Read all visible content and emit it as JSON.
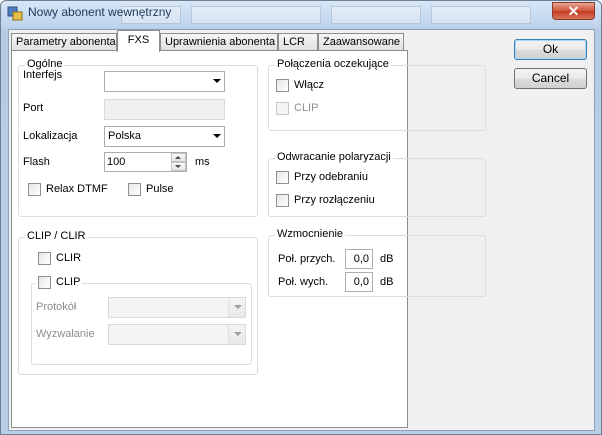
{
  "window": {
    "title": "Nowy abonent wewnętrzny",
    "close_glyph": "✕"
  },
  "tabs": [
    {
      "label": "Parametry abonenta",
      "active": false
    },
    {
      "label": "FXS",
      "active": true
    },
    {
      "label": "Uprawnienia abonenta",
      "active": false
    },
    {
      "label": "LCR",
      "active": false
    },
    {
      "label": "Zaawansowane",
      "active": false
    }
  ],
  "general": {
    "legend": "Ogólne",
    "interface_label": "Interfejs",
    "interface_value": "",
    "port_label": "Port",
    "location_label": "Lokalizacja",
    "location_value": "Polska",
    "flash_label": "Flash",
    "flash_value": "100",
    "flash_unit": "ms",
    "relax_dtmf_label": "Relax DTMF",
    "pulse_label": "Pulse"
  },
  "clip_clir": {
    "legend": "CLIP / CLIR",
    "clir_label": "CLIR",
    "clip_label": "CLIP",
    "protocol_label": "Protokół",
    "trigger_label": "Wyzwalanie"
  },
  "waiting_calls": {
    "legend": "Połączenia oczekujące",
    "enable_label": "Włącz",
    "clip_label": "CLIP"
  },
  "polarity": {
    "legend": "Odwracanie polaryzacji",
    "on_answer_label": "Przy odebraniu",
    "on_disconnect_label": "Przy rozłączeniu"
  },
  "gain": {
    "legend": "Wzmocnienie",
    "incoming_label": "Poł. przych.",
    "incoming_value": "0,0",
    "incoming_unit": "dB",
    "outgoing_label": "Poł. wych.",
    "outgoing_value": "0,0",
    "outgoing_unit": "dB"
  },
  "buttons": {
    "ok": "Ok",
    "cancel": "Cancel"
  }
}
